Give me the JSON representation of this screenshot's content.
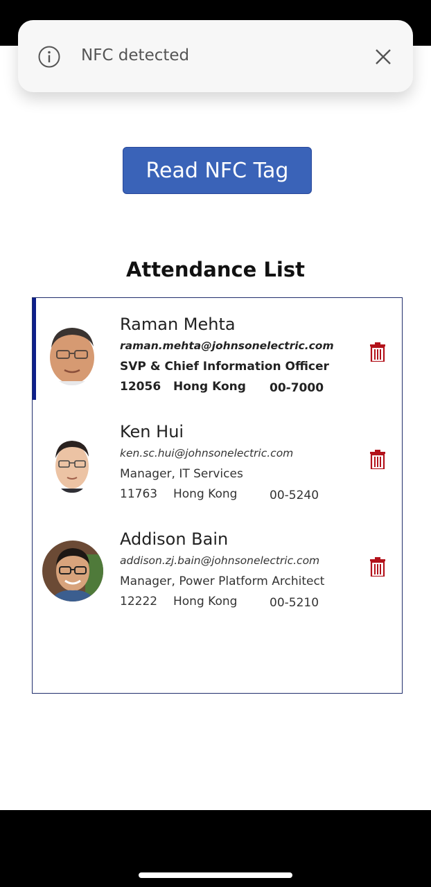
{
  "toast": {
    "message": "NFC detected",
    "info_icon": "info-circle-icon",
    "close_icon": "close-icon"
  },
  "read_button": {
    "label": "Read NFC Tag"
  },
  "attendance": {
    "title": "Attendance List",
    "people": [
      {
        "name": "Raman Mehta",
        "email": "raman.mehta@johnsonelectric.com",
        "job_title": "SVP & Chief Information Officer",
        "employee_no": "12056",
        "location": "Hong Kong",
        "extension": "00-7000",
        "selected": true
      },
      {
        "name": "Ken Hui",
        "email": "ken.sc.hui@johnsonelectric.com",
        "job_title": "Manager, IT Services",
        "employee_no": "11763",
        "location": "Hong Kong",
        "extension": "00-5240",
        "selected": false
      },
      {
        "name": "Addison Bain",
        "email": "addison.zj.bain@johnsonelectric.com",
        "job_title": "Manager, Power Platform Architect",
        "employee_no": "12222",
        "location": "Hong Kong",
        "extension": "00-5210",
        "selected": false
      }
    ]
  },
  "colors": {
    "button_bg": "#3a63b8",
    "trash_icon": "#b3121b",
    "gallery_border": "#1f2d6b",
    "selected_indicator": "#0e1f8a"
  }
}
